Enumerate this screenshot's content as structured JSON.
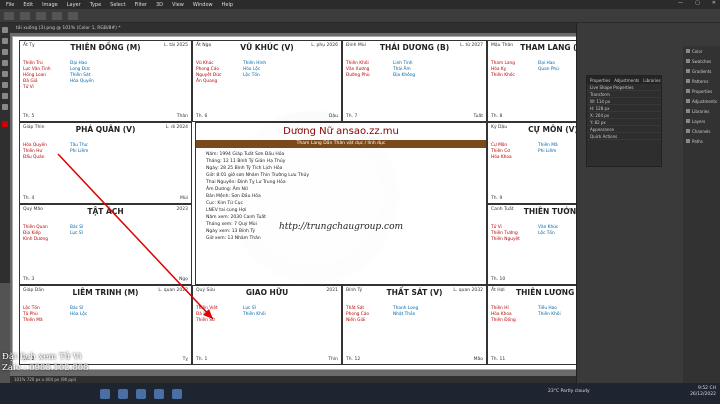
{
  "menu": [
    "File",
    "Edit",
    "Image",
    "Layer",
    "Type",
    "Select",
    "Filter",
    "3D",
    "View",
    "Window",
    "Help"
  ],
  "window_controls": [
    "—",
    "▢",
    "✕"
  ],
  "tab_title": "tải xuống (3).png @ 101% (Color 1, RGB/8#) *",
  "chart_title": "Dương Nữ ansao.zz.mu",
  "chart_subtitle": "Tham Lang Dần Thân vật dục / lính dục",
  "chart_url": "http://trungchaugroup.com",
  "center_rows": [
    [
      "Năm:",
      "1994",
      "Giáp",
      "Tuất",
      "Sơn Đầu Hỏa"
    ],
    [
      "Tháng:",
      "12",
      "11",
      "Bính",
      "Tý",
      "Giản Hạ Thủy"
    ],
    [
      "Ngày:",
      "28",
      "25",
      "Bính",
      "Tý",
      "Tích Lịch Hỏa"
    ],
    [
      "Giờ:",
      "8:01",
      "giờ sơn",
      "Nhâm",
      "Thìn",
      "Trường Lưu Thủy"
    ],
    [
      "Thai Nguyên:",
      "",
      "",
      "Đinh",
      "Tỵ",
      "Lư Trung Hỏa"
    ],
    [
      "Âm Dương:",
      "Âm Nữ"
    ],
    [
      "Bản Mệnh:",
      "Sơn Đầu Hỏa"
    ],
    [
      "Cục:",
      "Kim Tứ Cục"
    ],
    [
      "LNEV tai cung Hợi"
    ],
    [
      "Năm xem:",
      "2030",
      "Canh",
      "Tuất"
    ],
    [
      "Tháng xem:",
      "7",
      "Quý",
      "Mùi"
    ],
    [
      "Ngày xem:",
      "13",
      "Bính",
      "Tý"
    ],
    [
      "Giờ xem:",
      "13",
      "Nhâm",
      "Thân"
    ]
  ],
  "cells": [
    {
      "name": "THIÊN ĐỒNG (M)",
      "left": "Ất Tỵ",
      "right": "L. tài 2025",
      "stars": [
        "Thiên Trù",
        "Lực Văn Tinh",
        "Hồng Loan",
        "Đà Giả",
        "Tử Vi"
      ],
      "stars2": [
        "Đại Hao",
        "Long Đức",
        "Thiên Sát",
        "Hóa Quyền"
      ],
      "foot_l": "Th. 5",
      "foot_r": "Thân"
    },
    {
      "name": "VŨ KHÚC (V)",
      "left": "Ất Ngọ",
      "right": "L. phụ 2026",
      "stars": [
        "Vũ Khúc",
        "Phong Cáo",
        "Nguyệt Đức",
        "Ân Quang"
      ],
      "stars2": [
        "Thiên Hình",
        "Hóa Lộc",
        "Lộc Tồn"
      ],
      "foot_l": "Th. 6",
      "foot_r": "Dậu"
    },
    {
      "name": "THÁI DƯƠNG (B)",
      "left": "Đinh Mùi",
      "right": "L. tử 2027",
      "stars": [
        "Thiên Khôi",
        "Văn Xương",
        "Đường Phù"
      ],
      "stars2": [
        "Linh Tinh",
        "Thái Âm",
        "Địa Không"
      ],
      "foot_l": "Th. 7",
      "foot_r": "Tuất"
    },
    {
      "name": "THAM LANG (B)",
      "left": "Mậu Thân",
      "right": "L. phu 2028",
      "stars": [
        "Tham Lang",
        "Hóa Kỵ",
        "Thiên Khốc"
      ],
      "stars2": [
        "Đại Hao",
        "Quan Phù"
      ],
      "foot_l": "Th. 8",
      "foot_r": "Hợi"
    },
    {
      "name": "PHÁ QUÂN (V)",
      "left": "Giáp Thìn",
      "right": "L. di 2024",
      "stars": [
        "Hóa Quyền",
        "Thiên Hư",
        "Đẩu Quân"
      ],
      "stars2": [
        "Tấu Thư",
        "Phi Liêm"
      ],
      "foot_l": "Th. 4",
      "foot_r": "Mùi"
    },
    {
      "name": "CỰ MÔN (V)",
      "left": "Kỷ Dậu",
      "right": "L. ng 2029",
      "stars": [
        "Cự Môn",
        "Thiên Cơ",
        "Hóa Khoa"
      ],
      "stars2": [
        "Thiên Mã",
        "Phi Liêm"
      ],
      "foot_l": "Th. 9",
      "foot_r": "Tý"
    },
    {
      "name": "TẬT ÁCH",
      "left": "Quý Mão",
      "right": "2023",
      "stars": [
        "Thiên Quan",
        "Địa Kiếp",
        "Kình Dương"
      ],
      "stars2": [
        "Bác Sĩ",
        "Lực Sĩ"
      ],
      "foot_l": "Th. 3",
      "foot_r": "Ngọ"
    },
    {
      "name": "THIÊN TƯỚNG",
      "left": "Canh Tuất",
      "right": "L. di 2030",
      "stars": [
        "Tử Vi",
        "Thiên Tướng",
        "Thiên Nguyệt"
      ],
      "stars2": [
        "Văn Khúc",
        "Lộc Tồn"
      ],
      "foot_l": "Th. 10",
      "foot_r": "Sửu"
    },
    {
      "name": "LIÊM TRINH (M)",
      "left": "Giáp Dần",
      "right": "L. quan 2022",
      "stars": [
        "Lộc Tồn",
        "Tả Phù",
        "Thiên Mã"
      ],
      "stars2": [
        "Bác Sĩ",
        "Hóa Lộc"
      ],
      "foot_l": "Th. 2",
      "foot_r": "Tỵ"
    },
    {
      "name": "GIAO HỮU",
      "left": "Quý Sửu",
      "right": "2021",
      "stars": [
        "Thiên Việt",
        "Đà La",
        "Thiên Sứ"
      ],
      "stars2": [
        "Lực Sĩ",
        "Thiên Khôi"
      ],
      "foot_l": "Th. 1",
      "foot_r": "Thìn"
    },
    {
      "name": "THẤT SÁT (V)",
      "left": "Bính Tý",
      "right": "L. quan 2032",
      "stars": [
        "Thất Sát",
        "Phong Cáo",
        "Niên Giải"
      ],
      "stars2": [
        "Thanh Long",
        "Nhật Thần"
      ],
      "foot_l": "Th. 12",
      "foot_r": "Mão"
    },
    {
      "name": "THIÊN LƯƠNG (H)",
      "left": "Ất Hợi",
      "right": "L. phụ 2031",
      "stars": [
        "Thiên Hỉ",
        "Hóa Khoa",
        "Thiên Đồng"
      ],
      "stars2": [
        "Tiểu Hao",
        "Thiên Khôi"
      ],
      "foot_l": "Th. 11",
      "foot_r": "Dần"
    }
  ],
  "right_panel": [
    "Color",
    "Swatches",
    "Gradients",
    "Patterns",
    "Properties",
    "Adjustments",
    "Libraries",
    "Layers",
    "Channels",
    "Paths"
  ],
  "properties": {
    "title": "Properties",
    "tab2": "Adjustments",
    "tab3": "Libraries",
    "rows": [
      "Live Shape Properties",
      "Transform",
      "W: 114 px",
      "H: 128 px",
      "X: 204 px",
      "Y: 82 px",
      "Appearance",
      "Quick Actions"
    ]
  },
  "status": "101%    720 px x 404 px (96 ppi)",
  "overlay": [
    "Đặt lịch xem Tử Vi",
    "Zalo : 0983.102.808"
  ],
  "weather": "23°C  Partly cloudy",
  "clock": [
    "9:52 CH",
    "26/12/2022"
  ]
}
